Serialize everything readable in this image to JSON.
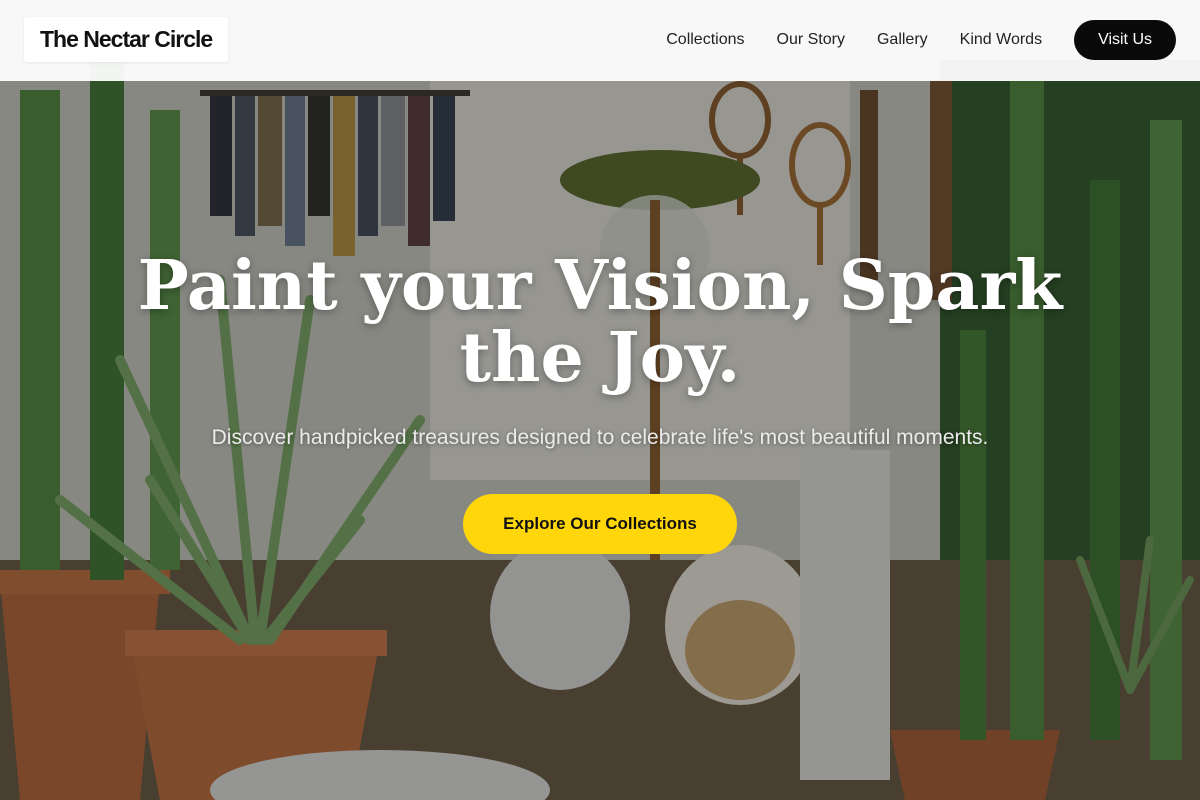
{
  "header": {
    "logo_text": "The Nectar Circle",
    "nav": [
      {
        "label": "Collections"
      },
      {
        "label": "Our Story"
      },
      {
        "label": "Gallery"
      },
      {
        "label": "Kind Words"
      }
    ],
    "visit_button": "Visit Us"
  },
  "hero": {
    "title": "Paint your Vision, Spark the Joy.",
    "subtitle": "Discover handpicked treasures designed to celebrate life's most beautiful moments.",
    "cta_label": "Explore Our Collections"
  },
  "colors": {
    "cta_background": "#ffd60a",
    "visit_button_background": "#0a0a0a",
    "header_background": "#ffffff"
  }
}
